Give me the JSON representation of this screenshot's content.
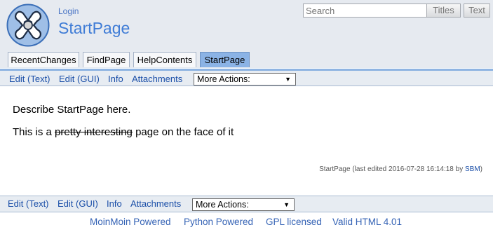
{
  "header": {
    "login": "Login",
    "site_title": "StartPage",
    "search": {
      "placeholder": "Search",
      "titles_label": "Titles",
      "text_label": "Text"
    }
  },
  "tabs": [
    {
      "label": "RecentChanges",
      "active": false
    },
    {
      "label": "FindPage",
      "active": false
    },
    {
      "label": "HelpContents",
      "active": false
    },
    {
      "label": "StartPage",
      "active": true
    }
  ],
  "actions": {
    "edit_text": "Edit (Text)",
    "edit_gui": "Edit (GUI)",
    "info": "Info",
    "attachments": "Attachments",
    "more_actions": "More Actions:"
  },
  "content": {
    "line1": "Describe StartPage here.",
    "line2_before": "This is a ",
    "line2_struck": "pretty interesting",
    "line2_after": " page on the face of it",
    "pageinfo_prefix": "StartPage (last edited 2016-07-28 16:14:18 by ",
    "pageinfo_user": "SBM",
    "pageinfo_suffix": ")"
  },
  "footer": {
    "moinmoin": "MoinMoin Powered",
    "python": "Python Powered",
    "gpl": "GPL licensed",
    "html": "Valid HTML 4.01"
  },
  "colors": {
    "header_bg": "#e6eaf0",
    "active_tab": "#8bb3e5",
    "link": "#1b4fa8",
    "title": "#3f7cd6"
  }
}
